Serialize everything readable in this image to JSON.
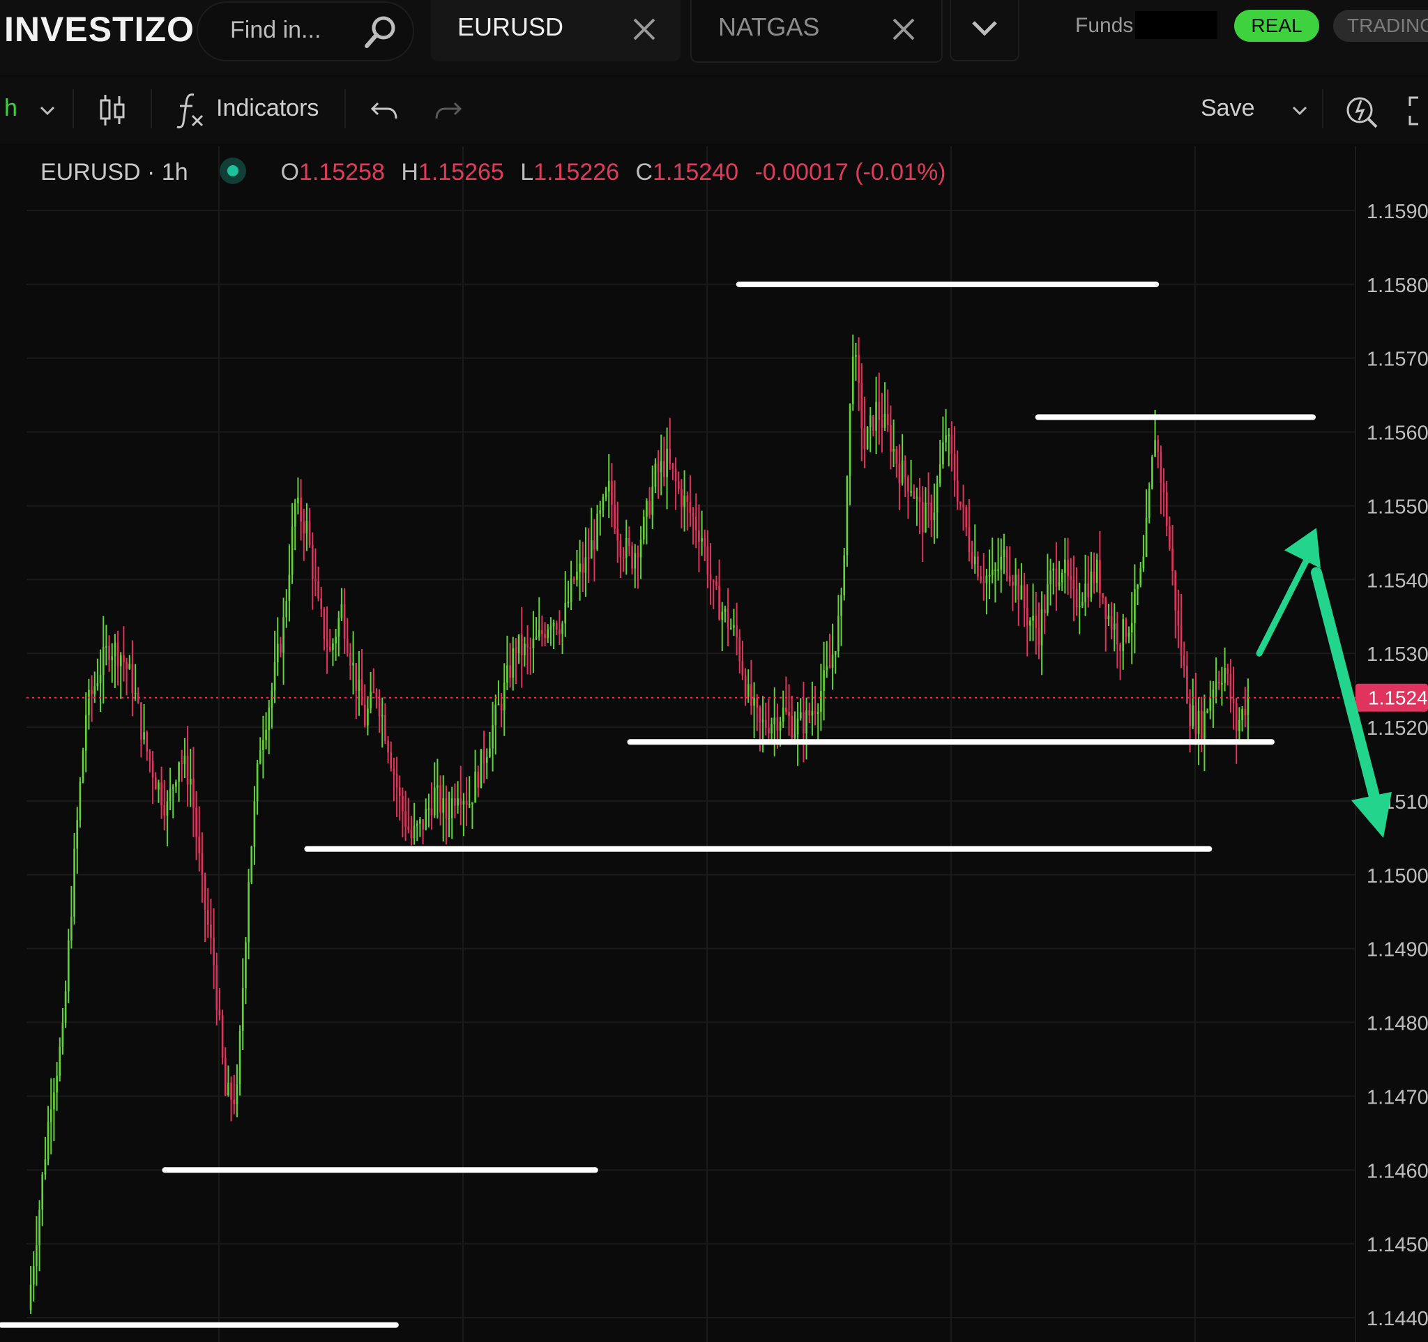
{
  "app": {
    "logo_text": "INVESTIZO"
  },
  "search": {
    "placeholder": "Find in..."
  },
  "tabs": [
    {
      "label": "EURUSD"
    },
    {
      "label": "NATGAS"
    }
  ],
  "account": {
    "funds_label": "Funds:",
    "real_label": "REAL",
    "trading_label": "TRADING"
  },
  "toolbar": {
    "interval_label": "h",
    "indicators_label": "Indicators",
    "save_label": "Save"
  },
  "legend": {
    "symbol": "EURUSD · 1h",
    "open_key": "O",
    "open": "1.15258",
    "high_key": "H",
    "high": "1.15265",
    "low_key": "L",
    "low": "1.15226",
    "close_key": "C",
    "close": "1.15240",
    "change": "-0.00017 (-0.01%)"
  },
  "colors": {
    "up": "#63d33a",
    "down": "#e0335d",
    "background": "#0b0b0b",
    "drawing": "#ffffff",
    "arrow": "#22d48c",
    "price_tag": "#e0335d"
  },
  "icons": [
    "search-icon",
    "close-icon",
    "chevron-down-icon",
    "candles-icon",
    "fx-icon",
    "undo-icon",
    "redo-icon",
    "alert-icon",
    "fullscreen-icon"
  ],
  "chart_data": {
    "type": "candlestick",
    "symbol": "EURUSD",
    "interval": "1h",
    "ylim": [
      1.144,
      1.159
    ],
    "yticks": [
      "1.1590",
      "1.1580",
      "1.1570",
      "1.1560",
      "1.1550",
      "1.1540",
      "1.1530",
      "1.1520",
      "1.1510",
      "1.1500",
      "1.1490",
      "1.1480",
      "1.1470",
      "1.1460",
      "1.1450",
      "1.1440"
    ],
    "last_price": "1.1524",
    "last_price_value": 1.1524,
    "close_path": [
      1.1441,
      1.1455,
      1.147,
      1.1478,
      1.1502,
      1.1522,
      1.1527,
      1.1531,
      1.153,
      1.1526,
      1.1518,
      1.1513,
      1.1509,
      1.1516,
      1.1513,
      1.1498,
      1.1488,
      1.147,
      1.147,
      1.15,
      1.1518,
      1.1525,
      1.1534,
      1.155,
      1.1547,
      1.1536,
      1.153,
      1.1536,
      1.1528,
      1.1521,
      1.1525,
      1.1518,
      1.151,
      1.1505,
      1.1507,
      1.1511,
      1.1508,
      1.1512,
      1.151,
      1.1515,
      1.152,
      1.1525,
      1.1531,
      1.153,
      1.1532,
      1.1535,
      1.1534,
      1.154,
      1.1542,
      1.1547,
      1.1552,
      1.1545,
      1.1543,
      1.1547,
      1.1554,
      1.1556,
      1.1552,
      1.1549,
      1.1546,
      1.1538,
      1.1535,
      1.1532,
      1.1524,
      1.152,
      1.1521,
      1.1522,
      1.152,
      1.1521,
      1.1524,
      1.1528,
      1.1536,
      1.1572,
      1.1558,
      1.1563,
      1.156,
      1.1555,
      1.1553,
      1.1548,
      1.155,
      1.156,
      1.1552,
      1.1545,
      1.1541,
      1.154,
      1.1543,
      1.154,
      1.1535,
      1.1533,
      1.154,
      1.1542,
      1.1537,
      1.1539,
      1.1541,
      1.1535,
      1.1532,
      1.1535,
      1.1542,
      1.156,
      1.1548,
      1.1533,
      1.1522,
      1.152,
      1.1526,
      1.1528,
      1.152,
      1.1524
    ],
    "horizontal_lines": [
      {
        "price": 1.158,
        "x_from": 0.555,
        "x_to": 0.85
      },
      {
        "price": 1.1562,
        "x_from": 0.78,
        "x_to": 0.968
      },
      {
        "price": 1.1518,
        "x_from": 0.473,
        "x_to": 0.937
      },
      {
        "price": 1.15035,
        "x_from": 0.23,
        "x_to": 0.89
      },
      {
        "price": 1.146,
        "x_from": 0.123,
        "x_to": 0.428
      },
      {
        "price": 1.1439,
        "x_from": 0.0,
        "x_to": 0.278
      }
    ],
    "arrows": [
      {
        "direction": "up",
        "from_price": 1.153,
        "to_price": 1.1547
      },
      {
        "direction": "down",
        "from_price": 1.154,
        "to_price": 1.1505
      }
    ]
  }
}
